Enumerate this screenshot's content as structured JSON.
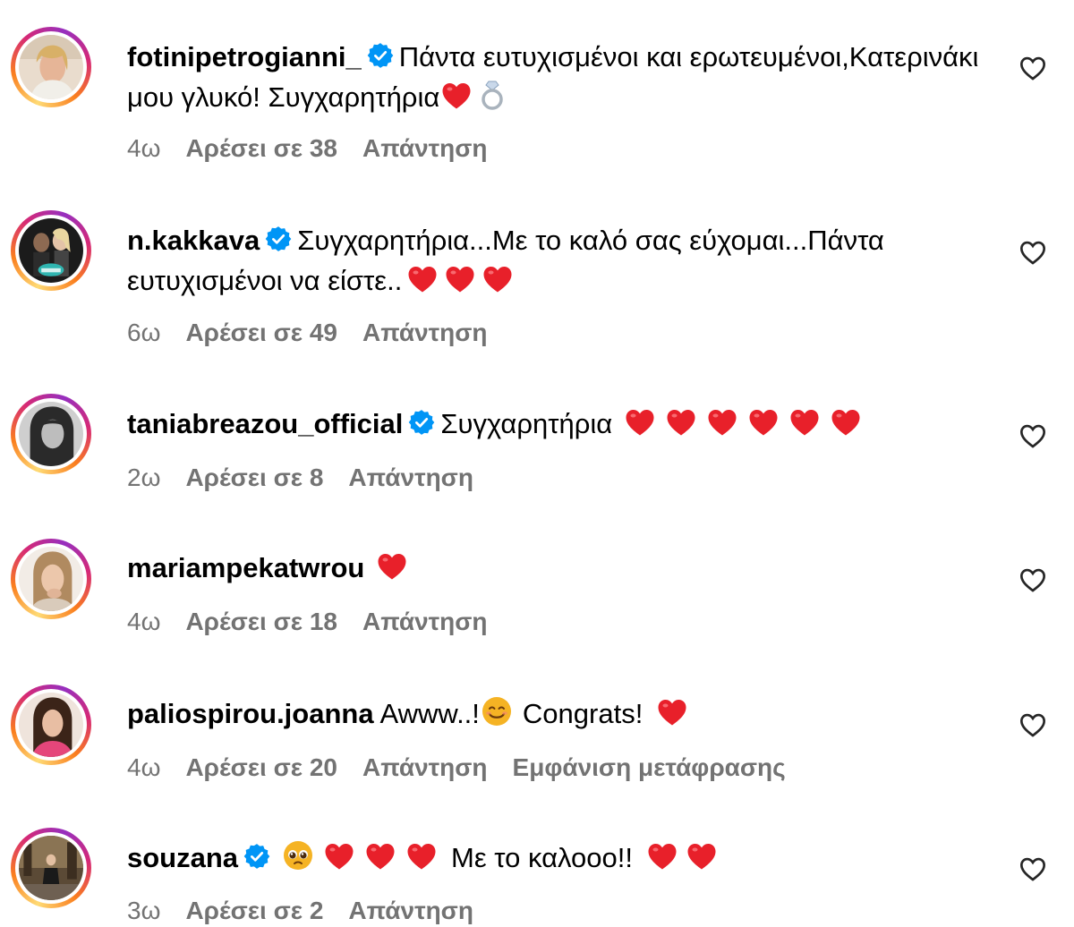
{
  "comments": [
    {
      "username": "fotinipetrogianni_",
      "verified": true,
      "text": "Πάντα ευτυχισμένοι και ερωτευμένοι,Κατερινάκι μου γλυκό! Συγχαρητήρια",
      "emojis_after": [
        "red-heart",
        "ring"
      ],
      "time": "4ω",
      "likes": "Αρέσει σε 38",
      "reply": "Απάντηση",
      "avatar": "avatar-photo-blonde-woman"
    },
    {
      "username": "n.kakkava",
      "verified": true,
      "text": "Συγχαρητήρια...Με το καλό σας εύχομαι...Πάντα ευτυχισμένοι να είστε..",
      "emojis_after": [
        "red-heart",
        "red-heart",
        "red-heart"
      ],
      "time": "6ω",
      "likes": "Αρέσει σε 49",
      "reply": "Απάντηση",
      "avatar": "avatar-photo-couple-tv-logo"
    },
    {
      "username": "taniabreazou_official",
      "verified": true,
      "text": "Συγχαρητήρια",
      "emojis_after": [
        "red-heart",
        "red-heart",
        "red-heart",
        "red-heart",
        "red-heart",
        "red-heart"
      ],
      "time": "2ω",
      "likes": "Αρέσει σε 8",
      "reply": "Απάντηση",
      "avatar": "avatar-photo-black-white-woman"
    },
    {
      "username": "mariampekatwrou",
      "verified": false,
      "text": "",
      "emojis_after": [
        "red-heart"
      ],
      "time": "4ω",
      "likes": "Αρέσει σε 18",
      "reply": "Απάντηση",
      "avatar": "avatar-photo-woman-hand"
    },
    {
      "username": "paliospirou.joanna",
      "verified": false,
      "text": "Awww..!",
      "text2": "Congrats!",
      "emojis_middle": [
        "smiling-face"
      ],
      "emojis_after": [
        "red-heart"
      ],
      "time": "4ω",
      "likes": "Αρέσει σε 20",
      "reply": "Απάντηση",
      "translate": "Εμφάνιση μετάφρασης",
      "avatar": "avatar-photo-woman-pink"
    },
    {
      "username": "souzana",
      "verified": true,
      "text": "Με το καλοοο!!",
      "emojis_before": [
        "pleading-face",
        "red-heart",
        "red-heart",
        "red-heart"
      ],
      "emojis_after": [
        "red-heart",
        "red-heart"
      ],
      "time": "3ω",
      "likes": "Αρέσει σε 2",
      "reply": "Απάντηση",
      "avatar": "avatar-photo-woman-street"
    }
  ],
  "colors": {
    "meta_text": "#737373",
    "verified_blue": "#0095f6",
    "heart_red": "#e8202a"
  },
  "icons": {
    "like": "heart-outline-icon",
    "verified": "verified-badge-icon"
  }
}
